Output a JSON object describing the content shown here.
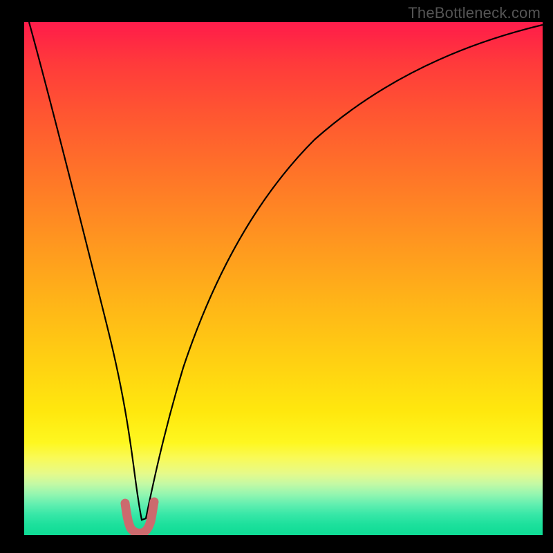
{
  "attribution": "TheBottleneck.com",
  "chart_data": {
    "type": "line",
    "title": "",
    "xlabel": "",
    "ylabel": "",
    "xlim": [
      0,
      100
    ],
    "ylim": [
      0,
      100
    ],
    "background_gradient": {
      "top_color": "#ff1d4c",
      "mid_color": "#ffd012",
      "bottom_color": "#0fdc95"
    },
    "series": [
      {
        "name": "bottleneck-curve",
        "color": "#000000",
        "x": [
          1,
          3,
          6,
          9,
          12,
          15,
          17,
          19,
          20.5,
          22,
          23.5,
          25,
          28,
          32,
          38,
          45,
          55,
          65,
          78,
          90,
          100
        ],
        "y": [
          100,
          90,
          78,
          65,
          52,
          38,
          26,
          14,
          6,
          2,
          4,
          9,
          22,
          38,
          55,
          67,
          78,
          84,
          89,
          91.5,
          93
        ]
      },
      {
        "name": "minimum-marker",
        "color": "#cc6a6e",
        "x": [
          19.3,
          19.5,
          19.8,
          20.3,
          21.0,
          21.8,
          22.5,
          23.0,
          23.3,
          23.5
        ],
        "y": [
          6.0,
          3.5,
          1.8,
          0.9,
          0.6,
          0.9,
          1.8,
          3.5,
          5.0,
          6.0
        ]
      }
    ],
    "minimum": {
      "x": 21,
      "y": 0.6
    }
  }
}
